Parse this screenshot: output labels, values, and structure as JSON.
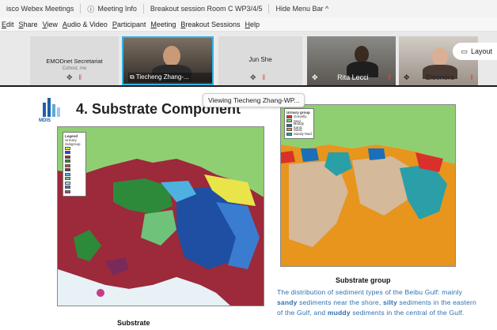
{
  "titlebar": {
    "app": "isco Webex Meetings",
    "meeting_info": "Meeting Info",
    "breakout": "Breakout session Room C WP3/4/5",
    "hide_menu": "Hide Menu Bar ^"
  },
  "menu": [
    "Edit",
    "Share",
    "View",
    "Audio & Video",
    "Participant",
    "Meeting",
    "Breakout Sessions",
    "Help"
  ],
  "participants": [
    {
      "name": "EMODnet Secretariat",
      "sub": "Cohost, me"
    },
    {
      "name": "Tiecheng Zhang-..."
    },
    {
      "name": "Jun She"
    },
    {
      "name": "Rita Lecci"
    },
    {
      "name": "Eleonora"
    }
  ],
  "layout_label": "Layout",
  "viewing_banner": "Viewing Tiecheng Zhang-WP...",
  "slide": {
    "logo_text": "MDIS",
    "title": "4. Substrate Component",
    "left_caption": "Substrate",
    "right_caption": "Substrate group",
    "description_parts": {
      "p1": "The distribution of sediment types of the Beibu Gulf: mainly ",
      "sandy": "sandy",
      "p2": " sediments near the shore, ",
      "silty": "silty",
      "p3": " sediments in the eastern of the Gulf, and ",
      "muddy": "muddy",
      "p4": " sediments in the central of the Gulf."
    },
    "right_legend": {
      "title": "Urmary group",
      "items": [
        {
          "label": "Gravelly",
          "color": "#d9302c"
        },
        {
          "label": "Mud",
          "color": "#8fbf6a"
        },
        {
          "label": "Muddy Sand",
          "color": "#1a6fb8"
        },
        {
          "label": "Sand",
          "color": "#e7951d"
        },
        {
          "label": "Sandy Mud",
          "color": "#2a9fa8"
        }
      ]
    },
    "left_legend": {
      "title": "Legend",
      "subtitle": "Urmary",
      "subtitle2": "Subgroup",
      "colors": [
        "#e9e44a",
        "#1e4fa3",
        "#9c2a3a",
        "#2d8a3b",
        "#b15a4a",
        "#7a2a5a",
        "#4fb1e0",
        "#6fc27a",
        "#a7d8e8",
        "#3a7dd0",
        "#c93a8a"
      ]
    }
  },
  "colors": {
    "accent": "#2fb3e8",
    "menu_separator": "#1a1a1a",
    "desc_blue": "#2e6fb0"
  }
}
